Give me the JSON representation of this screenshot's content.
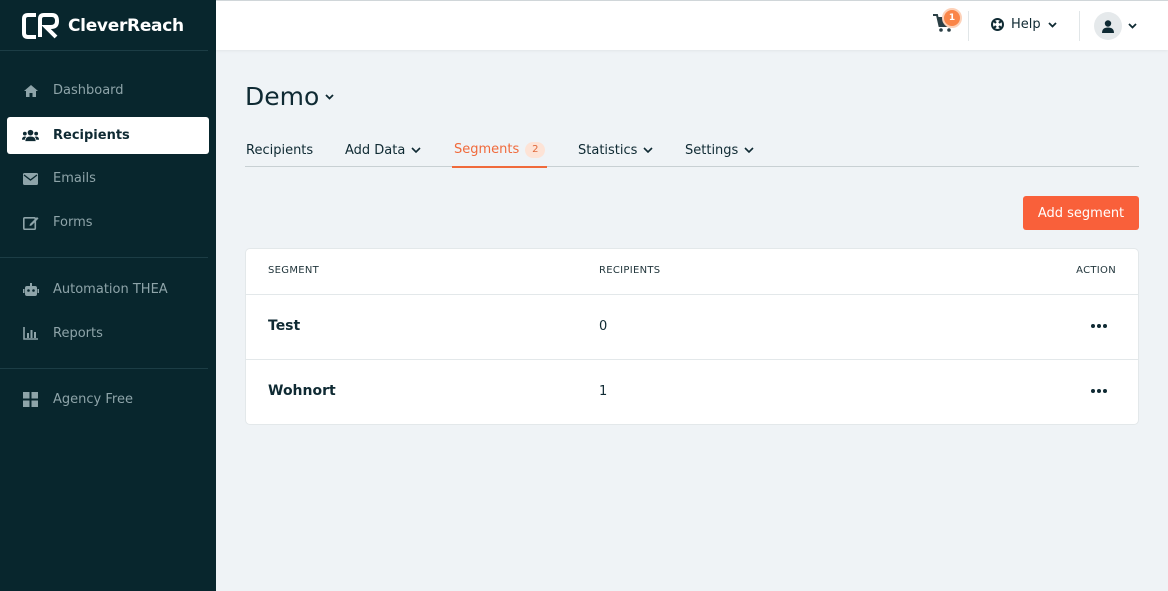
{
  "app": {
    "brand": "CleverReach"
  },
  "sidebar": {
    "items": [
      {
        "label": "Dashboard",
        "icon": "home-icon"
      },
      {
        "label": "Recipients",
        "icon": "users-icon",
        "active": true
      },
      {
        "label": "Emails",
        "icon": "envelope-icon"
      },
      {
        "label": "Forms",
        "icon": "edit-icon"
      },
      {
        "label": "Automation THEA",
        "icon": "robot-icon"
      },
      {
        "label": "Reports",
        "icon": "chart-icon"
      },
      {
        "label": "Agency Free",
        "icon": "grid-icon"
      }
    ]
  },
  "header": {
    "cart_count": "1",
    "help_label": "Help"
  },
  "page": {
    "title": "Demo",
    "tabs": [
      {
        "label": "Recipients"
      },
      {
        "label": "Add Data"
      },
      {
        "label": "Segments",
        "badge": "2",
        "active": true
      },
      {
        "label": "Statistics"
      },
      {
        "label": "Settings"
      }
    ],
    "add_button": "Add segment"
  },
  "table": {
    "columns": [
      "SEGMENT",
      "RECIPIENTS",
      "ACTION"
    ],
    "rows": [
      {
        "segment": "Test",
        "recipients": "0"
      },
      {
        "segment": "Wohnort",
        "recipients": "1"
      }
    ]
  },
  "colors": {
    "sidebar_bg": "#08262d",
    "accent": "#f9603a",
    "page_bg": "#eff3f6"
  }
}
